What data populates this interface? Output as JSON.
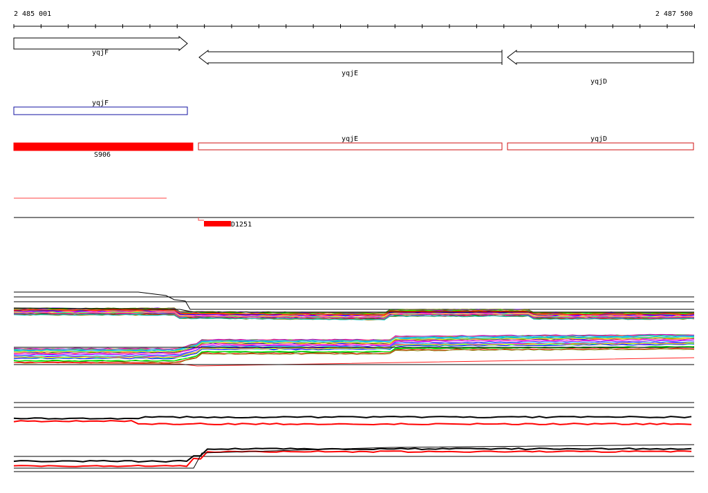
{
  "ruler": {
    "start_label": "2 485 001",
    "end_label": "2 487 500",
    "start": 2485001,
    "end": 2487500
  },
  "genes": [
    {
      "label": "yqjF",
      "start": 2485001,
      "end": 2485650,
      "strand": "+"
    },
    {
      "label": "yqjE",
      "start": 2485680,
      "end": 2486800,
      "strand": "-"
    },
    {
      "label": "yqjD",
      "start": 2486820,
      "end": 2487500,
      "strand": "-"
    }
  ],
  "annotation_track": [
    {
      "label": "yqjF",
      "start": 2485001,
      "end": 2485650,
      "color": "#1010a0"
    }
  ],
  "feature_track": [
    {
      "label": "S906",
      "start": 2485001,
      "end": 2485660,
      "filled": true,
      "color": "#ff0000"
    },
    {
      "label": "yqjE",
      "start": 2485680,
      "end": 2486800,
      "filled": false,
      "color": "#d01010"
    },
    {
      "label": "yqjD",
      "start": 2486820,
      "end": 2487500,
      "filled": false,
      "color": "#d01010"
    }
  ],
  "red_line_feature": {
    "start": 2485001,
    "end": 2485565,
    "color": "#ff4040"
  },
  "segment_feature": {
    "label": "D1251",
    "start": 2485700,
    "end": 2485800,
    "color": "#ff0000"
  },
  "colors": {
    "profile_palette": [
      "#ff00ff",
      "#00c0ff",
      "#00ff00",
      "#ffff00",
      "#0000ff",
      "#ff8000",
      "#00ff80",
      "#8000ff",
      "#ff0000",
      "#008000",
      "#c000c0",
      "#00c0c0",
      "#808000",
      "#ff6080"
    ],
    "black": "#000000",
    "red": "#ff0000",
    "blue": "#1010a0"
  }
}
